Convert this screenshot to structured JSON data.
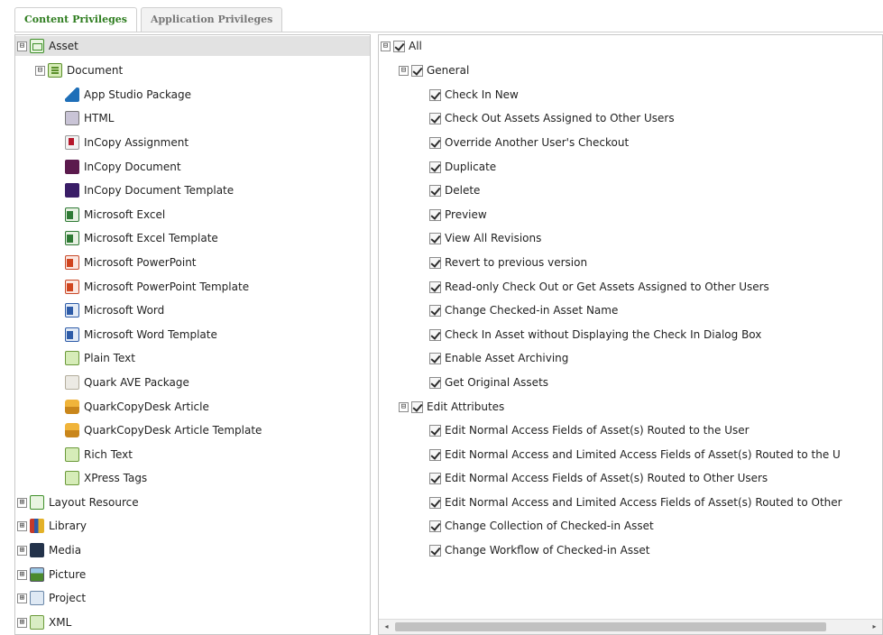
{
  "tabs": [
    {
      "label": "Content Privileges",
      "active": true
    },
    {
      "label": "Application Privileges",
      "active": false
    }
  ],
  "tree": {
    "root": {
      "label": "Asset",
      "expander": "⊟",
      "selected": true
    },
    "document": {
      "label": "Document",
      "expander": "⊟"
    },
    "document_children": [
      {
        "label": "App Studio Package",
        "icon": "app-studio-package-icon"
      },
      {
        "label": "HTML",
        "icon": "html-icon"
      },
      {
        "label": "InCopy Assignment",
        "icon": "incopy-assignment-icon"
      },
      {
        "label": "InCopy Document",
        "icon": "incopy-document-icon"
      },
      {
        "label": "InCopy Document Template",
        "icon": "incopy-document-template-icon"
      },
      {
        "label": "Microsoft Excel",
        "icon": "microsoft-excel-icon"
      },
      {
        "label": "Microsoft Excel Template",
        "icon": "microsoft-excel-template-icon"
      },
      {
        "label": "Microsoft PowerPoint",
        "icon": "microsoft-powerpoint-icon"
      },
      {
        "label": "Microsoft PowerPoint Template",
        "icon": "microsoft-powerpoint-template-icon"
      },
      {
        "label": "Microsoft Word",
        "icon": "microsoft-word-icon"
      },
      {
        "label": "Microsoft Word Template",
        "icon": "microsoft-word-template-icon"
      },
      {
        "label": "Plain Text",
        "icon": "plain-text-icon"
      },
      {
        "label": "Quark AVE Package",
        "icon": "quark-ave-package-icon"
      },
      {
        "label": "QuarkCopyDesk Article",
        "icon": "quarkcopydesk-article-icon"
      },
      {
        "label": "QuarkCopyDesk Article Template",
        "icon": "quarkcopydesk-article-template-icon"
      },
      {
        "label": "Rich Text",
        "icon": "rich-text-icon"
      },
      {
        "label": "XPress Tags",
        "icon": "xpress-tags-icon"
      }
    ],
    "top_level": [
      {
        "label": "Layout Resource",
        "expander": "⊞",
        "icon": "layout-resource-icon"
      },
      {
        "label": "Library",
        "expander": "⊞",
        "icon": "library-icon"
      },
      {
        "label": "Media",
        "expander": "⊞",
        "icon": "media-icon"
      },
      {
        "label": "Picture",
        "expander": "⊞",
        "icon": "picture-icon"
      },
      {
        "label": "Project",
        "expander": "⊞",
        "icon": "project-icon"
      },
      {
        "label": "XML",
        "expander": "⊞",
        "icon": "xml-icon"
      }
    ]
  },
  "privileges": {
    "all": {
      "label": "All",
      "checked": true,
      "expander": "⊟"
    },
    "general": {
      "label": "General",
      "checked": true,
      "expander": "⊟"
    },
    "general_items": [
      {
        "label": "Check In New",
        "checked": true
      },
      {
        "label": "Check Out Assets Assigned to Other Users",
        "checked": true
      },
      {
        "label": "Override Another User's Checkout",
        "checked": true
      },
      {
        "label": "Duplicate",
        "checked": true
      },
      {
        "label": "Delete",
        "checked": true
      },
      {
        "label": "Preview",
        "checked": true
      },
      {
        "label": "View All Revisions",
        "checked": true
      },
      {
        "label": "Revert to previous version",
        "checked": true
      },
      {
        "label": "Read-only Check Out or Get Assets Assigned to Other Users",
        "checked": true
      },
      {
        "label": "Change Checked-in Asset Name",
        "checked": true
      },
      {
        "label": "Check In Asset without Displaying the Check In Dialog Box",
        "checked": true
      },
      {
        "label": "Enable Asset Archiving",
        "checked": true
      },
      {
        "label": "Get Original Assets",
        "checked": true
      }
    ],
    "edit_attributes": {
      "label": "Edit Attributes",
      "checked": true,
      "expander": "⊟"
    },
    "edit_items": [
      {
        "label": "Edit Normal Access Fields of Asset(s) Routed to the User",
        "checked": true
      },
      {
        "label": "Edit Normal Access and Limited Access Fields of Asset(s) Routed to the U",
        "checked": true
      },
      {
        "label": "Edit Normal Access Fields of Asset(s) Routed to Other Users",
        "checked": true
      },
      {
        "label": "Edit Normal Access and Limited Access Fields of Asset(s) Routed to Other",
        "checked": true
      },
      {
        "label": "Change Collection of Checked-in Asset",
        "checked": true
      },
      {
        "label": "Change Workflow of Checked-in Asset",
        "checked": true
      }
    ]
  },
  "scrollbar": {
    "left_arrow": "◂",
    "right_arrow": "▸"
  }
}
